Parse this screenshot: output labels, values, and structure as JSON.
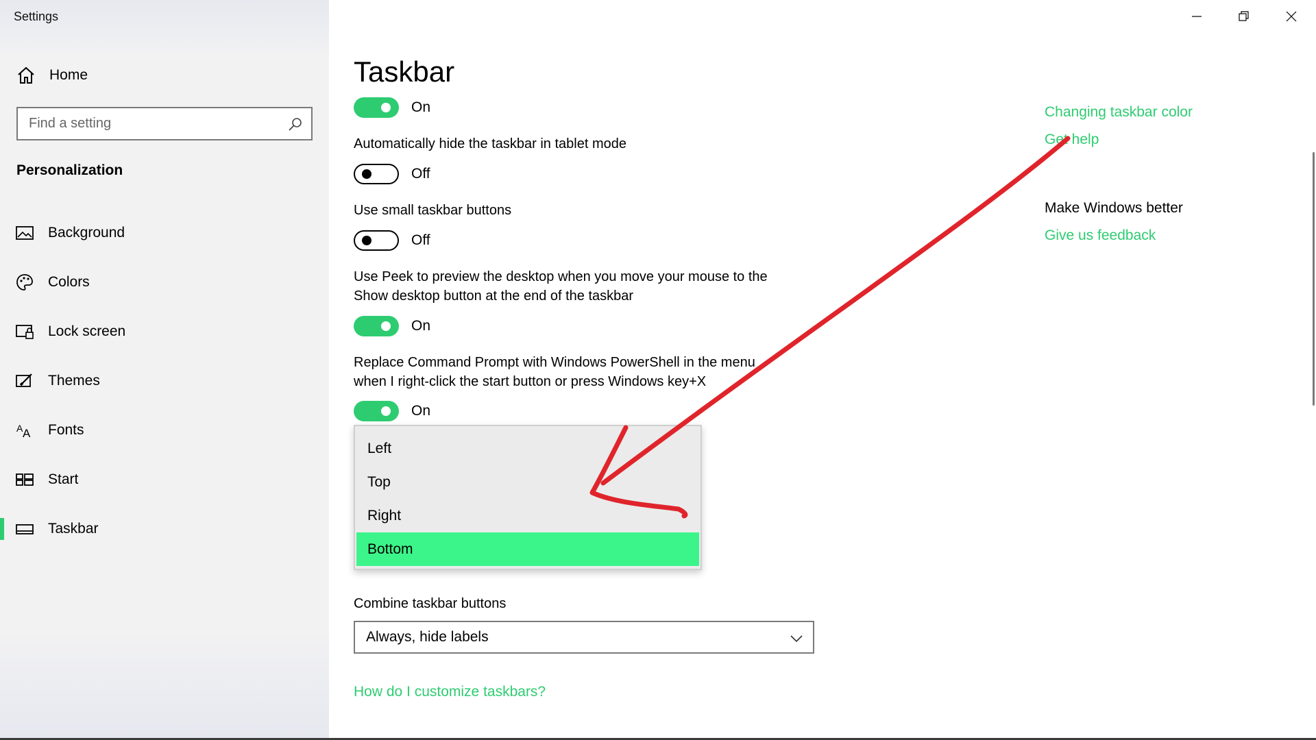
{
  "window": {
    "title": "Settings"
  },
  "sidebar": {
    "home_label": "Home",
    "search_placeholder": "Find a setting",
    "section_heading": "Personalization",
    "items": [
      {
        "label": "Background",
        "icon": "background-picture-icon"
      },
      {
        "label": "Colors",
        "icon": "palette-icon"
      },
      {
        "label": "Lock screen",
        "icon": "lock-screen-icon"
      },
      {
        "label": "Themes",
        "icon": "themes-brush-icon"
      },
      {
        "label": "Fonts",
        "icon": "fonts-icon"
      },
      {
        "label": "Start",
        "icon": "start-grid-icon"
      },
      {
        "label": "Taskbar",
        "icon": "taskbar-icon",
        "selected": true
      }
    ]
  },
  "main": {
    "title": "Taskbar",
    "settings": [
      {
        "label": "",
        "state": "On",
        "on": true
      },
      {
        "label": "Automatically hide the taskbar in tablet mode",
        "state": "Off",
        "on": false
      },
      {
        "label": "Use small taskbar buttons",
        "state": "Off",
        "on": false
      },
      {
        "label_line1": "Use Peek to preview the desktop when you move your mouse to the",
        "label_line2": "Show desktop button at the end of the taskbar",
        "state": "On",
        "on": true
      },
      {
        "label_line1": "Replace Command Prompt with Windows PowerShell in the menu",
        "label_line2": "when I right-click the start button or press Windows key+X",
        "state": "On",
        "on": true
      }
    ],
    "location_dropdown": {
      "options": [
        "Left",
        "Top",
        "Right",
        "Bottom"
      ],
      "selected": "Bottom"
    },
    "combine": {
      "label": "Combine taskbar buttons",
      "value": "Always, hide labels"
    },
    "help_link": "How do I customize taskbars?"
  },
  "related": {
    "link_color": "Changing taskbar color",
    "link_help": "Get help",
    "feedback_heading": "Make Windows better",
    "link_feedback": "Give us feedback"
  },
  "colors": {
    "accent": "#2ecc71",
    "highlight": "#3cf58a",
    "annotation": "#e0242b"
  }
}
